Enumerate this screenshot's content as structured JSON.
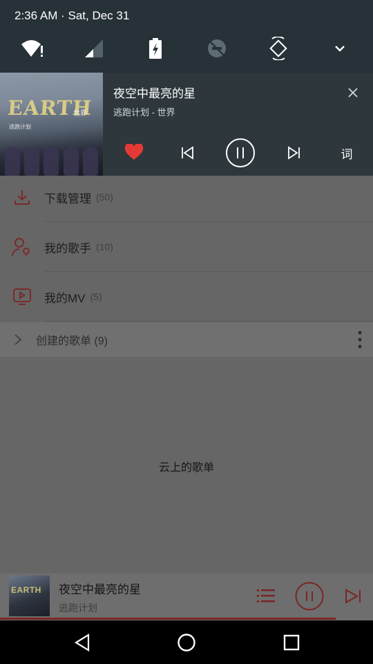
{
  "status_bar": {
    "time_date": "2:36 AM · Sat, Dec 31"
  },
  "quick_settings": {
    "icons": [
      "wifi-alert-icon",
      "cell-signal-icon",
      "battery-charging-icon",
      "do-not-disturb-off-icon",
      "auto-rotate-icon",
      "expand-chevron-icon"
    ]
  },
  "notification": {
    "song_title": "夜空中最亮的星",
    "artist_album": "逃跑计划 - 世界",
    "album_art_text": {
      "title": "EARTH",
      "subtitle": "世界",
      "band": "逃跑计划"
    },
    "lyrics_label": "词",
    "liked": true,
    "accent_color": "#e53935"
  },
  "library": {
    "items": [
      {
        "label": "下载管理",
        "count": "(50)",
        "icon": "download-icon"
      },
      {
        "label": "我的歌手",
        "count": "(10)",
        "icon": "singer-icon"
      },
      {
        "label": "我的MV",
        "count": "(5)",
        "icon": "mv-icon"
      }
    ],
    "created_playlists": "创建的歌单 (9)",
    "cloud_playlists": "云上的歌单"
  },
  "mini_player": {
    "song_title": "夜空中最亮的星",
    "artist": "逃跑计划",
    "album_art_text": "EARTH",
    "progress_fraction": 0.9,
    "accent_color": "#7a2525"
  }
}
